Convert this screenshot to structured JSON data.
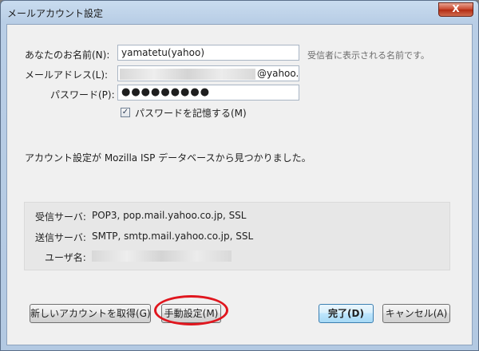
{
  "window": {
    "title": "メールアカウント設定",
    "close_glyph": "X"
  },
  "form": {
    "name_label": "あなたのお名前(N):",
    "name_value": "yamatetu(yahoo)",
    "name_hint": "受信者に表示される名前です。",
    "email_label": "メールアドレス(L):",
    "email_suffix": "@yahoo.c",
    "password_label": "パスワード(P):",
    "password_value": "●●●●●●●●●",
    "remember_label": "パスワードを記憶する(M)",
    "remember_checked": "✓"
  },
  "status": {
    "message": "アカウント設定が Mozilla ISP データベースから見つかりました。"
  },
  "servers": {
    "incoming_label": "受信サーバ:",
    "incoming_value": "POP3, pop.mail.yahoo.co.jp, SSL",
    "outgoing_label": "送信サーバ:",
    "outgoing_value": "SMTP, smtp.mail.yahoo.co.jp, SSL",
    "username_label": "ユーザ名:"
  },
  "buttons": {
    "new_account": "新しいアカウントを取得(G)",
    "manual_config": "手動設定(M)",
    "done": "完了(D)",
    "cancel": "キャンセル(A)"
  },
  "colors": {
    "highlight_ring": "#e0161e",
    "primary_button_border": "#3c7fb1"
  }
}
